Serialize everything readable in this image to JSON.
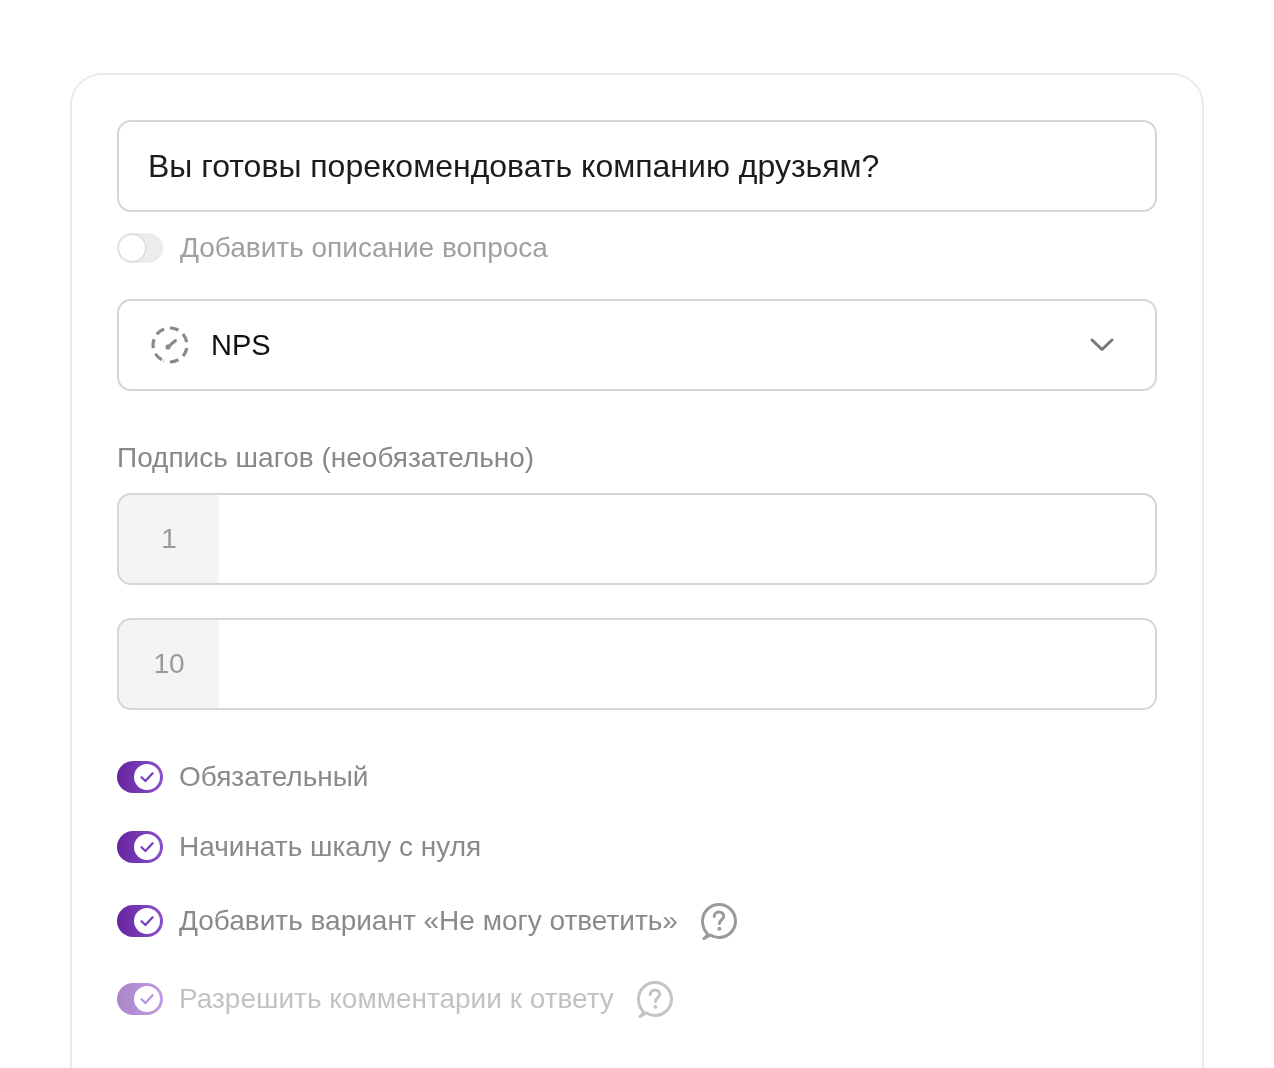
{
  "question": {
    "value": "Вы готовы порекомендовать компанию друзьям?"
  },
  "description_toggle": {
    "label": "Добавить описание вопроса",
    "on": false
  },
  "type_select": {
    "value": "NPS"
  },
  "steps": {
    "label": "Подпись шагов (необязательно)",
    "fields": [
      {
        "number": "1"
      },
      {
        "number": "10"
      }
    ]
  },
  "options": [
    {
      "label": "Обязательный",
      "on": true,
      "disabled": false,
      "help": false
    },
    {
      "label": "Начинать шкалу с нуля",
      "on": true,
      "disabled": false,
      "help": false
    },
    {
      "label": "Добавить вариант «Не могу ответить»",
      "on": true,
      "disabled": false,
      "help": true
    },
    {
      "label": "Разрешить комментарии к ответу",
      "on": true,
      "disabled": true,
      "help": true
    }
  ]
}
